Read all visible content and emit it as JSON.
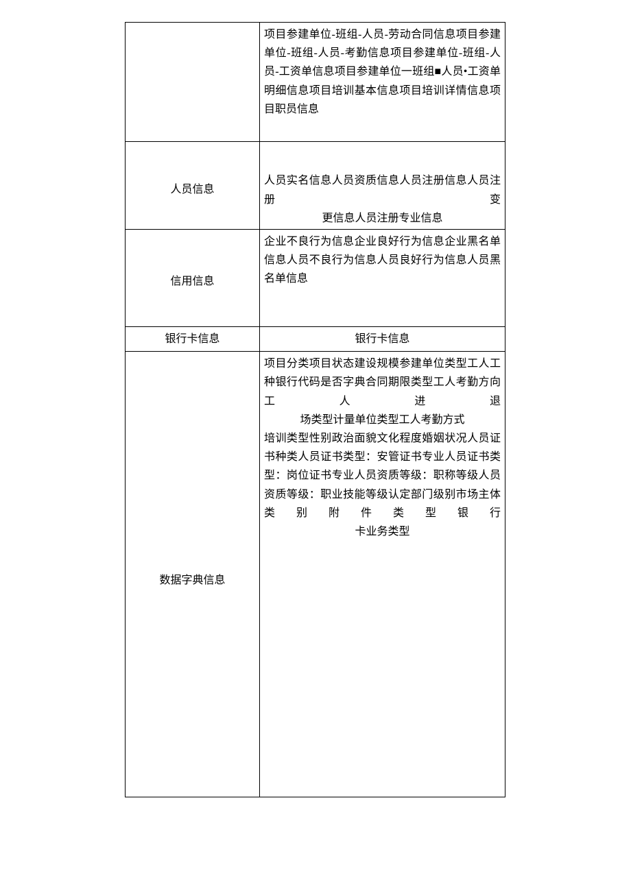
{
  "rows": [
    {
      "left": "",
      "right": "项目参建单位-班组-人员-劳动合同信息项目参建单位-班组-人员-考勤信息项目参建单位-班组-人员-工资单信息项目参建单位一班组■人员•工资单明细信息项目培训基本信息项目培训详情信息项目职员信息"
    },
    {
      "left": "人员信息",
      "right_main": "人员实名信息人员资质信息人员注册信息人员注册变",
      "right_last": "更信息人员注册专业信息"
    },
    {
      "left": "信用信息",
      "right": "企业不良行为信息企业良好行为信息企业黑名单信息人员不良行为信息人员良好行为信息人员黑名单信息"
    },
    {
      "left": "银行卡信息",
      "right": "银行卡信息"
    },
    {
      "left": "数据字典信息",
      "right_p1_main": "项目分类项目状态建设规模参建单位类型工人工种银行代码是否字典合同期限类型工人考勤方向工人进退",
      "right_p1_last": "场类型计量单位类型工人考勤方式",
      "right_p2_main": "培训类型性别政治面貌文化程度婚姻状况人员证书种类人员证书类型：安管证书专业人员证书类型：岗位证书专业人员资质等级：职称等级人员资质等级：职业技能等级认定部门级别市场主体类别附件类型银行",
      "right_p2_last": "卡业务类型"
    }
  ]
}
